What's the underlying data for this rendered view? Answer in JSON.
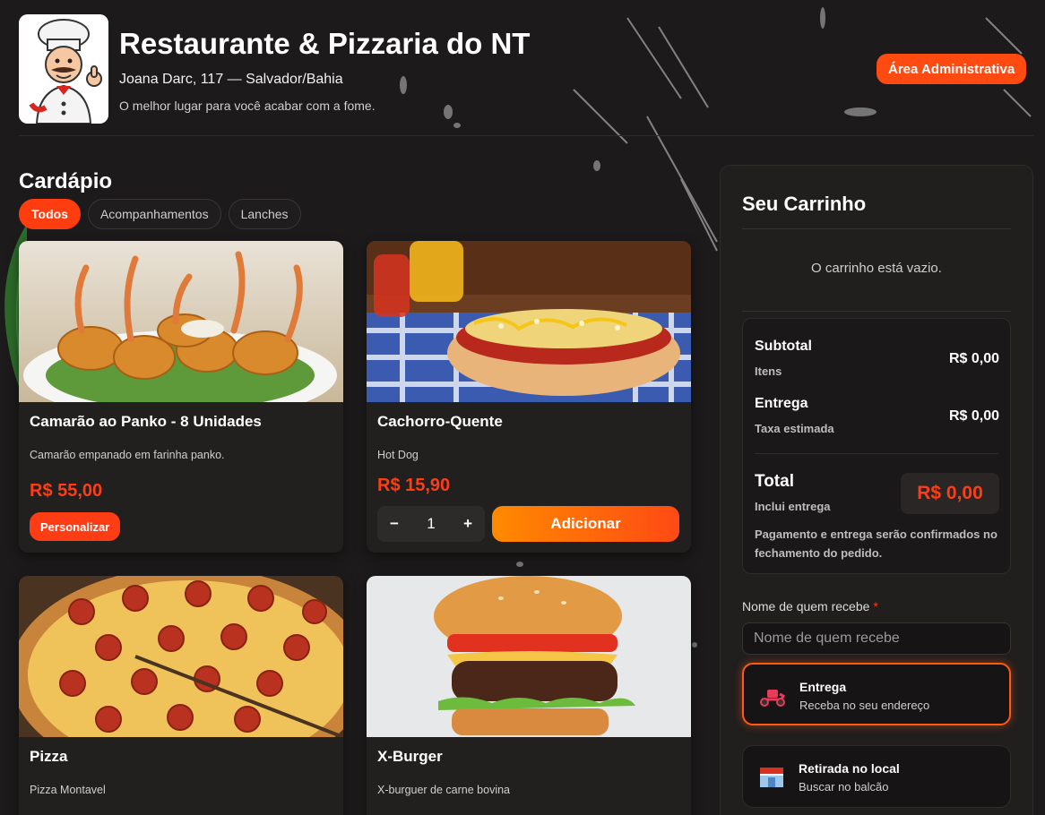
{
  "header": {
    "title": "Restaurante & Pizzaria do NT",
    "address": "Joana Darc, 117 — Salvador/Bahia",
    "tagline": "O melhor lugar para você acabar com a fome.",
    "admin_button": "Área Administrativa"
  },
  "menu": {
    "title": "Cardápio",
    "tabs": [
      {
        "label": "Todos",
        "active": true
      },
      {
        "label": "Acompanhamentos",
        "active": false
      },
      {
        "label": "Lanches",
        "active": false
      }
    ],
    "items": [
      {
        "name": "Camarão ao Panko - 8 Unidades",
        "description": "Camarão empanado em farinha panko.",
        "price": "R$ 55,00",
        "action": "Personalizar",
        "image": "fried-shrimp"
      },
      {
        "name": "Cachorro-Quente",
        "description": "Hot Dog",
        "price": "R$ 15,90",
        "quantity": "1",
        "action": "Adicionar",
        "minus": "−",
        "plus": "+",
        "image": "hot-dog"
      },
      {
        "name": "Pizza",
        "description": "Pizza Montavel",
        "image": "pepperoni-pizza"
      },
      {
        "name": "X-Burger",
        "description": "X-burguer de carne bovina",
        "image": "burger"
      }
    ]
  },
  "cart": {
    "title": "Seu Carrinho",
    "empty_message": "O carrinho está vazio.",
    "subtotal_label": "Subtotal",
    "subtotal_sub": "Itens",
    "subtotal_value": "R$ 0,00",
    "delivery_label": "Entrega",
    "delivery_sub": "Taxa estimada",
    "delivery_value": "R$ 0,00",
    "total_label": "Total",
    "total_sub": "Inclui entrega",
    "total_value": "R$ 0,00",
    "note": "Pagamento e entrega serão confirmados no fechamento do pedido.",
    "name_label": "Nome de quem recebe",
    "required_mark": "*",
    "name_placeholder": "Nome de quem recebe",
    "options": [
      {
        "title": "Entrega",
        "subtitle": "Receba no seu endereço",
        "icon": "scooter-icon",
        "selected": true
      },
      {
        "title": "Retirada no local",
        "subtitle": "Buscar no balcão",
        "icon": "store-icon",
        "selected": false
      }
    ]
  },
  "colors": {
    "accent": "#ff3d14",
    "background": "#1c1a1a",
    "card": "#221f1f"
  }
}
